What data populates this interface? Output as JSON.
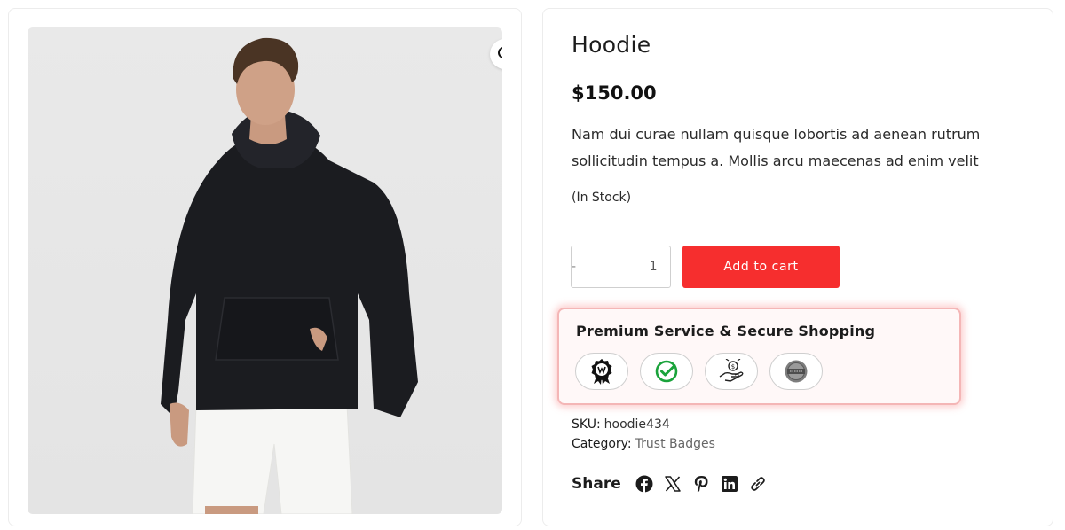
{
  "product": {
    "title": "Hoodie",
    "price": "$150.00",
    "description": "Nam dui curae nullam quisque lobortis ad aenean rutrum sollicitudin tempus a. Mollis arcu maecenas ad enim velit",
    "stock_status": "(In Stock)"
  },
  "gallery": {
    "zoom_icon": "magnifier-icon"
  },
  "cart": {
    "minus_label": "-",
    "quantity": "1",
    "plus_label": "+",
    "add_to_cart_label": "Add to cart"
  },
  "trust_badges": {
    "title": "Premium Service & Secure Shopping",
    "badges": [
      "award-ribbon-icon",
      "check-circle-icon",
      "hand-money-icon",
      "seal-icon"
    ],
    "border_color": "#f4b6b6"
  },
  "meta": {
    "sku_label": "SKU:",
    "sku_value": "hoodie434",
    "category_label": "Category:",
    "category_value": "Trust Badges"
  },
  "share": {
    "label": "Share",
    "icons": [
      "facebook-icon",
      "x-icon",
      "pinterest-icon",
      "linkedin-icon",
      "copy-link-icon"
    ]
  },
  "colors": {
    "accent": "#f62e2e"
  }
}
